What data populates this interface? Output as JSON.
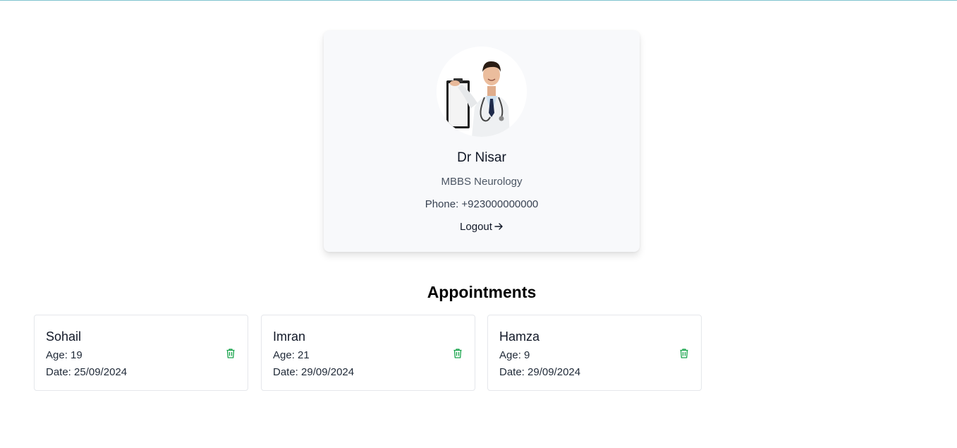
{
  "profile": {
    "name": "Dr Nisar",
    "qualification": "MBBS Neurology",
    "phone": "Phone: +923000000000",
    "logout_label": "Logout",
    "logout_icon": "arrow-right-icon"
  },
  "appointments_title": "Appointments",
  "appointments": [
    {
      "name": "Sohail",
      "age": "Age: 19",
      "date": "Date: 25/09/2024"
    },
    {
      "name": "Imran",
      "age": "Age: 21",
      "date": "Date: 29/09/2024"
    },
    {
      "name": "Hamza",
      "age": "Age: 9",
      "date": "Date: 29/09/2024"
    }
  ],
  "colors": {
    "delete_icon": "#16a34a",
    "card_bg": "#f8f9fb",
    "top_line": "#7fc3cf"
  }
}
